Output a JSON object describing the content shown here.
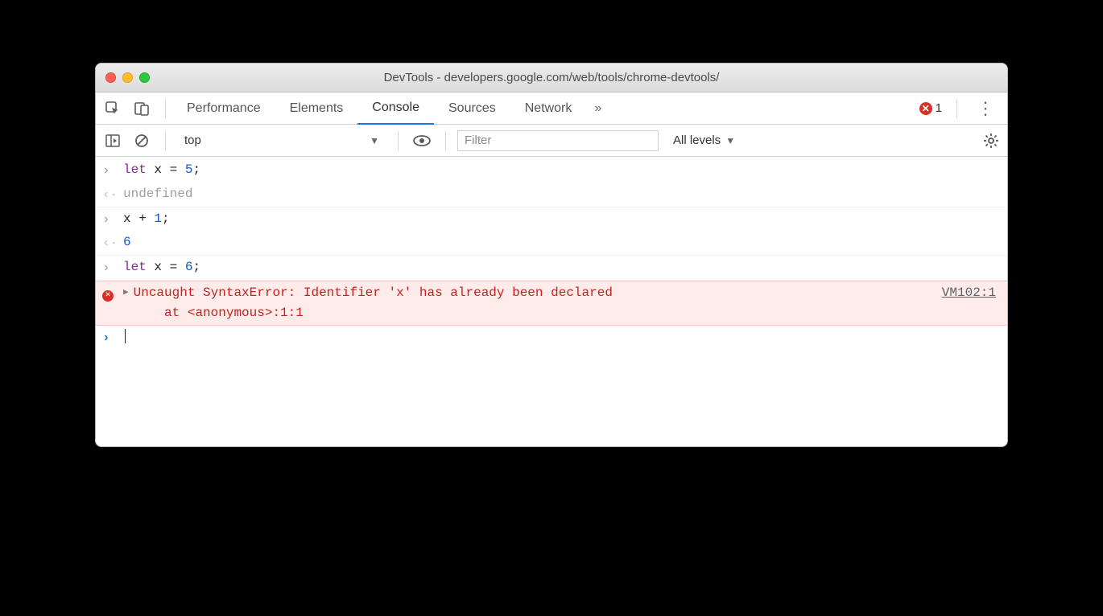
{
  "window": {
    "title": "DevTools - developers.google.com/web/tools/chrome-devtools/"
  },
  "tabs": {
    "items": [
      "Performance",
      "Elements",
      "Console",
      "Sources",
      "Network"
    ],
    "active_index": 2,
    "more_glyph": "»",
    "error_count": "1"
  },
  "filterbar": {
    "context": "top",
    "filter_placeholder": "Filter",
    "levels_label": "All levels"
  },
  "console": {
    "lines": [
      {
        "type": "in",
        "tokens": [
          [
            "kw",
            "let"
          ],
          [
            "txt",
            " x "
          ],
          [
            "txt",
            "= "
          ],
          [
            "nm",
            "5"
          ],
          [
            "txt",
            ";"
          ]
        ]
      },
      {
        "type": "out",
        "text": "undefined",
        "cls": "und"
      },
      {
        "type": "in",
        "tokens": [
          [
            "txt",
            "x "
          ],
          [
            "txt",
            "+ "
          ],
          [
            "nm",
            "1"
          ],
          [
            "txt",
            ";"
          ]
        ]
      },
      {
        "type": "out",
        "text": "6",
        "cls": "nm"
      },
      {
        "type": "in",
        "tokens": [
          [
            "kw",
            "let"
          ],
          [
            "txt",
            " x "
          ],
          [
            "txt",
            "= "
          ],
          [
            "nm",
            "6"
          ],
          [
            "txt",
            ";"
          ]
        ]
      }
    ],
    "error": {
      "message": "Uncaught SyntaxError: Identifier 'x' has already been declared",
      "stack": "    at <anonymous>:1:1",
      "source": "VM102:1"
    }
  }
}
